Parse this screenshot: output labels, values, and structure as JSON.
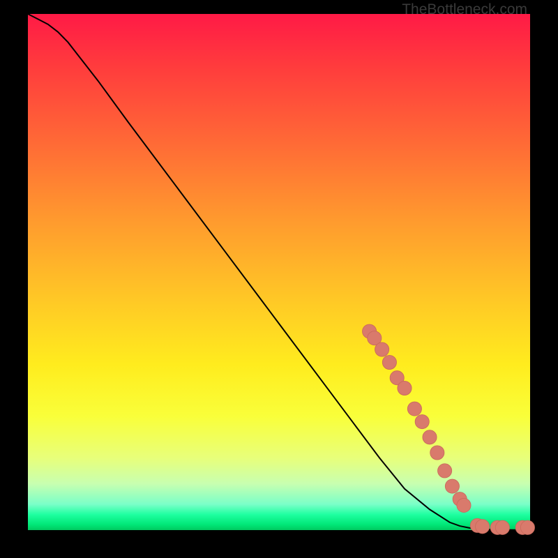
{
  "credit_text": "TheBottleneck.com",
  "colors": {
    "line": "#000000",
    "marker_fill": "#d97a6c",
    "marker_stroke": "#c96a5c",
    "background_black": "#000000"
  },
  "chart_data": {
    "type": "line",
    "title": "",
    "xlabel": "",
    "ylabel": "",
    "xlim": [
      0,
      100
    ],
    "ylim": [
      0,
      100
    ],
    "legend": false,
    "grid": false,
    "series": [
      {
        "name": "curve",
        "type": "line",
        "x": [
          0,
          2,
          4,
          6,
          8,
          10,
          14,
          20,
          30,
          40,
          50,
          60,
          70,
          75,
          80,
          84,
          86,
          88,
          90,
          94,
          100
        ],
        "y": [
          100,
          99,
          98,
          96.5,
          94.5,
          92,
          87,
          79,
          66,
          53,
          40,
          27,
          14,
          8,
          4,
          1.5,
          0.8,
          0.4,
          0.2,
          0.05,
          0
        ]
      },
      {
        "name": "markers",
        "type": "scatter",
        "points": [
          {
            "x": 68,
            "y": 38.5,
            "r": 1.4
          },
          {
            "x": 69,
            "y": 37.2,
            "r": 1.4
          },
          {
            "x": 70.5,
            "y": 35.0,
            "r": 1.4
          },
          {
            "x": 72,
            "y": 32.5,
            "r": 1.4
          },
          {
            "x": 73.5,
            "y": 29.5,
            "r": 1.4
          },
          {
            "x": 75,
            "y": 27.5,
            "r": 1.4
          },
          {
            "x": 77,
            "y": 23.5,
            "r": 1.4
          },
          {
            "x": 78.5,
            "y": 21.0,
            "r": 1.4
          },
          {
            "x": 80,
            "y": 18.0,
            "r": 1.4
          },
          {
            "x": 81.5,
            "y": 15.0,
            "r": 1.4
          },
          {
            "x": 83,
            "y": 11.5,
            "r": 1.4
          },
          {
            "x": 84.5,
            "y": 8.5,
            "r": 1.4
          },
          {
            "x": 86,
            "y": 6.0,
            "r": 1.4
          },
          {
            "x": 86.8,
            "y": 4.8,
            "r": 1.4
          },
          {
            "x": 89.5,
            "y": 0.9,
            "r": 1.4
          },
          {
            "x": 90.5,
            "y": 0.7,
            "r": 1.4
          },
          {
            "x": 93.5,
            "y": 0.5,
            "r": 1.4
          },
          {
            "x": 94.5,
            "y": 0.5,
            "r": 1.4
          },
          {
            "x": 98.5,
            "y": 0.5,
            "r": 1.4
          },
          {
            "x": 99.5,
            "y": 0.5,
            "r": 1.4
          }
        ]
      }
    ]
  }
}
